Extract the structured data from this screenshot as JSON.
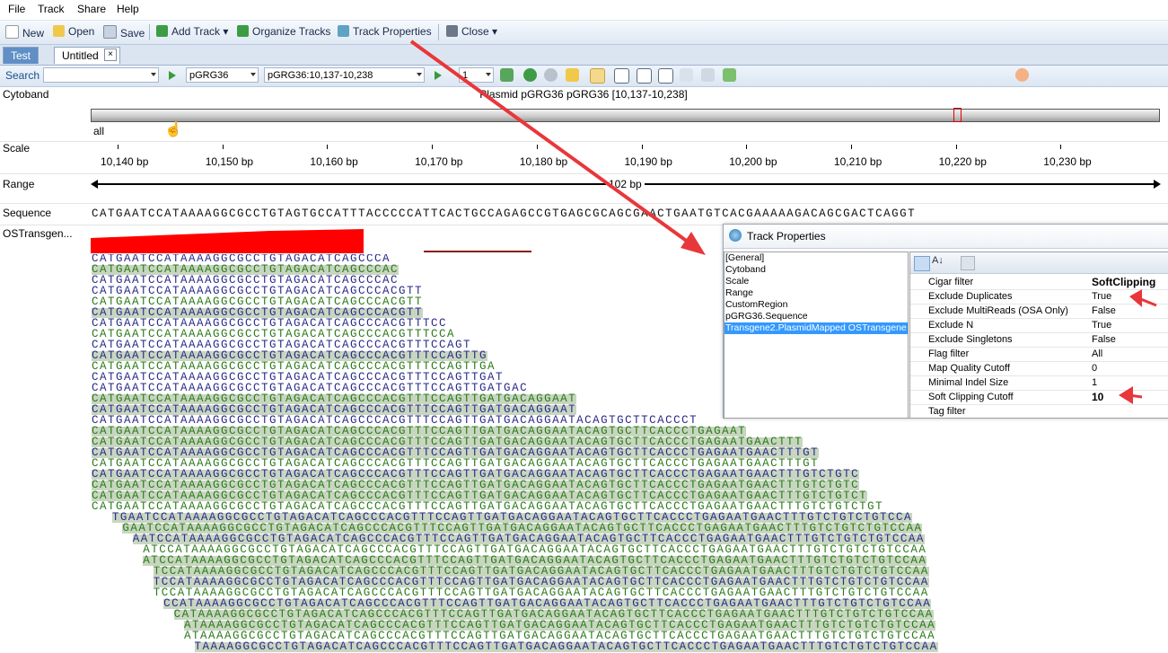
{
  "menu": {
    "items": [
      "File",
      "Track",
      "Share",
      "Help"
    ]
  },
  "toolbar": {
    "new": "New",
    "open": "Open",
    "save": "Save",
    "add_track": "Add Track",
    "organize": "Organize Tracks",
    "track_props": "Track Properties",
    "close": "Close"
  },
  "tabs": [
    "Test",
    "Untitled"
  ],
  "search": {
    "label": "Search",
    "query": "",
    "genome": "pGRG36",
    "region": "pGRG36:10,137-10,238",
    "zoom": "1"
  },
  "cytoband": {
    "label": "Cytoband",
    "title": "Plasmid pGRG36 pGRG36 [10,137-10,238]",
    "band_label": "all"
  },
  "scale": {
    "label": "Scale",
    "ticks": [
      "10,140 bp",
      "10,150 bp",
      "10,160 bp",
      "10,170 bp",
      "10,180 bp",
      "10,190 bp",
      "10,200 bp",
      "10,210 bp",
      "10,220 bp",
      "10,230 bp"
    ]
  },
  "range": {
    "label": "Range",
    "value": "102 bp"
  },
  "sequence": {
    "label": "Sequence",
    "bases": "CATGAATCCATAAAAGGCGCCTGTAGTGCCATTTACCCCCATTCACTGCCAGAGCCGTGAGCGCAGCGAACTGAATGTCACGAAAAAGACAGCGACTCAGGT"
  },
  "track": {
    "label": "OSTransgen..."
  },
  "reads": [
    "CATGAATCCATAAAAGGCGCCTGTAGACATCAGCCCA",
    "CATGAATCCATAAAAGGCGCCTGTAGACATCAGCCCAC",
    "CATGAATCCATAAAAGGCGCCTGTAGACATCAGCCCAC",
    "CATGAATCCATAAAAGGCGCCTGTAGACATCAGCCCACGTT",
    "CATGAATCCATAAAAGGCGCCTGTAGACATCAGCCCACGTT",
    "CATGAATCCATAAAAGGCGCCTGTAGACATCAGCCCACGTT",
    "CATGAATCCATAAAAGGCGCCTGTAGACATCAGCCCACGTTTCC",
    "CATGAATCCATAAAAGGCGCCTGTAGACATCAGCCCACGTTTCCA",
    "CATGAATCCATAAAAGGCGCCTGTAGACATCAGCCCACGTTTCCAGT",
    "CATGAATCCATAAAAGGCGCCTGTAGACATCAGCCCACGTTTCCAGTTG",
    "CATGAATCCATAAAAGGCGCCTGTAGACATCAGCCCACGTTTCCAGTTGA",
    "CATGAATCCATAAAAGGCGCCTGTAGACATCAGCCCACGTTTCCAGTTGAT",
    "CATGAATCCATAAAAGGCGCCTGTAGACATCAGCCCACGTTTCCAGTTGATGAC",
    "CATGAATCCATAAAAGGCGCCTGTAGACATCAGCCCACGTTTCCAGTTGATGACAGGAAT",
    "CATGAATCCATAAAAGGCGCCTGTAGACATCAGCCCACGTTTCCAGTTGATGACAGGAAT",
    "CATGAATCCATAAAAGGCGCCTGTAGACATCAGCCCACGTTTCCAGTTGATGACAGGAATACAGTGCTTCACCCT",
    "CATGAATCCATAAAAGGCGCCTGTAGACATCAGCCCACGTTTCCAGTTGATGACAGGAATACAGTGCTTCACCCTGAGAAT",
    "CATGAATCCATAAAAGGCGCCTGTAGACATCAGCCCACGTTTCCAGTTGATGACAGGAATACAGTGCTTCACCCTGAGAATGAACTTT",
    "CATGAATCCATAAAAGGCGCCTGTAGACATCAGCCCACGTTTCCAGTTGATGACAGGAATACAGTGCTTCACCCTGAGAATGAACTTTGT",
    "CATGAATCCATAAAAGGCGCCTGTAGACATCAGCCCACGTTTCCAGTTGATGACAGGAATACAGTGCTTCACCCTGAGAATGAACTTTGT",
    "CATGAATCCATAAAAGGCGCCTGTAGACATCAGCCCACGTTTCCAGTTGATGACAGGAATACAGTGCTTCACCCTGAGAATGAACTTTGTCTGTC",
    "CATGAATCCATAAAAGGCGCCTGTAGACATCAGCCCACGTTTCCAGTTGATGACAGGAATACAGTGCTTCACCCTGAGAATGAACTTTGTCTGTC",
    "CATGAATCCATAAAAGGCGCCTGTAGACATCAGCCCACGTTTCCAGTTGATGACAGGAATACAGTGCTTCACCCTGAGAATGAACTTTGTCTGTCT",
    "CATGAATCCATAAAAGGCGCCTGTAGACATCAGCCCACGTTTCCAGTTGATGACAGGAATACAGTGCTTCACCCTGAGAATGAACTTTGTCTGTCTGT",
    "TGAATCCATAAAAGGCGCCTGTAGACATCAGCCCACGTTTCCAGTTGATGACAGGAATACAGTGCTTCACCCTGAGAATGAACTTTGTCTGTCTGTCCA",
    "GAATCCATAAAAGGCGCCTGTAGACATCAGCCCACGTTTCCAGTTGATGACAGGAATACAGTGCTTCACCCTGAGAATGAACTTTGTCTGTCTGTCCAA",
    "AATCCATAAAAGGCGCCTGTAGACATCAGCCCACGTTTCCAGTTGATGACAGGAATACAGTGCTTCACCCTGAGAATGAACTTTGTCTGTCTGTCCAA",
    "ATCCATAAAAGGCGCCTGTAGACATCAGCCCACGTTTCCAGTTGATGACAGGAATACAGTGCTTCACCCTGAGAATGAACTTTGTCTGTCTGTCCAA",
    "ATCCATAAAAGGCGCCTGTAGACATCAGCCCACGTTTCCAGTTGATGACAGGAATACAGTGCTTCACCCTGAGAATGAACTTTGTCTGTCTGTCCAA",
    "TCCATAAAAGGCGCCTGTAGACATCAGCCCACGTTTCCAGTTGATGACAGGAATACAGTGCTTCACCCTGAGAATGAACTTTGTCTGTCTGTCCAA",
    "TCCATAAAAGGCGCCTGTAGACATCAGCCCACGTTTCCAGTTGATGACAGGAATACAGTGCTTCACCCTGAGAATGAACTTTGTCTGTCTGTCCAA",
    "TCCATAAAAGGCGCCTGTAGACATCAGCCCACGTTTCCAGTTGATGACAGGAATACAGTGCTTCACCCTGAGAATGAACTTTGTCTGTCTGTCCAA",
    "CCATAAAAGGCGCCTGTAGACATCAGCCCACGTTTCCAGTTGATGACAGGAATACAGTGCTTCACCCTGAGAATGAACTTTGTCTGTCTGTCCAA",
    "CATAAAAGGCGCCTGTAGACATCAGCCCACGTTTCCAGTTGATGACAGGAATACAGTGCTTCACCCTGAGAATGAACTTTGTCTGTCTGTCCAA",
    "ATAAAAGGCGCCTGTAGACATCAGCCCACGTTTCCAGTTGATGACAGGAATACAGTGCTTCACCCTGAGAATGAACTTTGTCTGTCTGTCCAA",
    "ATAAAAGGCGCCTGTAGACATCAGCCCACGTTTCCAGTTGATGACAGGAATACAGTGCTTCACCCTGAGAATGAACTTTGTCTGTCTGTCCAA",
    "TAAAAGGCGCCTGTAGACATCAGCCCACGTTTCCAGTTGATGACAGGAATACAGTGCTTCACCCTGAGAATGAACTTTGTCTGTCTGTCCAA"
  ],
  "dialog": {
    "title": "Track Properties",
    "nodes": [
      "[General]",
      "Cytoband",
      "Scale",
      "Range",
      "CustomRegion",
      "pGRG36.Sequence",
      "Transgene2.PlasmidMapped OSTransgene"
    ],
    "selected_node": "Transgene2.PlasmidMapped OSTransgene",
    "properties": [
      {
        "key": "Cigar filter",
        "value": "SoftClipping"
      },
      {
        "key": "Exclude Duplicates",
        "value": "True"
      },
      {
        "key": "Exclude MultiReads (OSA Only)",
        "value": "False"
      },
      {
        "key": "Exclude N",
        "value": "True"
      },
      {
        "key": "Exclude Singletons",
        "value": "False"
      },
      {
        "key": "Flag filter",
        "value": "All"
      },
      {
        "key": "Map Quality Cutoff",
        "value": "0"
      },
      {
        "key": "Minimal Indel Size",
        "value": "1"
      },
      {
        "key": "Soft Clipping Cutoff",
        "value": "10"
      },
      {
        "key": "Tag filter",
        "value": ""
      }
    ]
  },
  "colors": {
    "accent_red": "#e8373a",
    "read_blue": "#2a2a8a",
    "read_green": "#2a7a1a",
    "selection": "#3399ff",
    "coverage_red": "#ff0000"
  }
}
